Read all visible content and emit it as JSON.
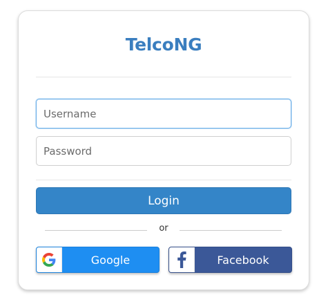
{
  "app": {
    "title": "TelcoNG"
  },
  "form": {
    "username_placeholder": "Username",
    "password_placeholder": "Password",
    "login_label": "Login",
    "or_label": "or"
  },
  "social": {
    "google_label": "Google",
    "google_icon": "google-g-icon",
    "facebook_label": "Facebook",
    "facebook_icon": "facebook-f-icon"
  },
  "colors": {
    "title": "#3a7ebf",
    "login_button": "#3485c8",
    "google_button": "#1e8ef2",
    "facebook_button": "#3b5898"
  }
}
